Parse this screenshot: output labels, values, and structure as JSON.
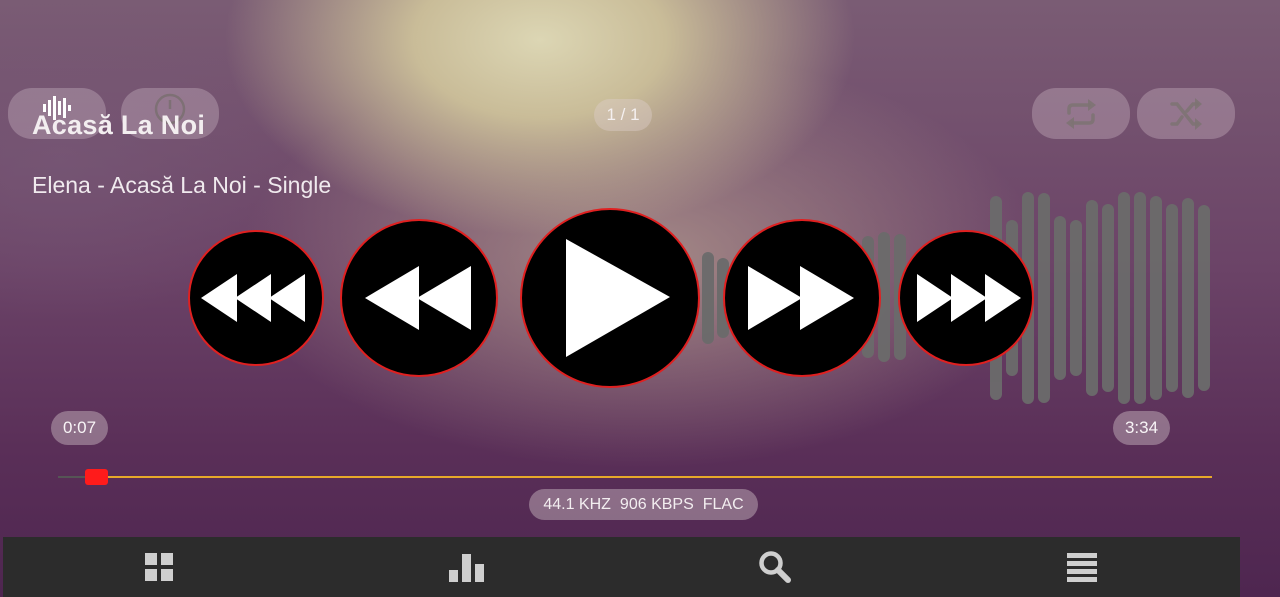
{
  "top_bar": {
    "visualizer_icon": "visualizer-bars-icon",
    "timer_icon": "timer-icon",
    "track_counter": "1 / 1",
    "repeat_icon": "repeat-icon",
    "shuffle_icon": "shuffle-icon"
  },
  "song": {
    "title": "Acasă La Noi",
    "subtitle": "Elena - Acasă La Noi - Single"
  },
  "controls": {
    "fast_rewind_icon": "fast-rewind-icon",
    "previous_icon": "rewind-icon",
    "play_icon": "play-icon",
    "next_icon": "forward-icon",
    "fast_forward_icon": "fast-forward-icon",
    "accent_color": "#e02020"
  },
  "progress": {
    "elapsed": "0:07",
    "duration": "3:34",
    "fraction": 0.033,
    "fill_color": "#e7a92a",
    "thumb_color": "#ff1b1b"
  },
  "audio_format": {
    "sample_rate": "44.1 KHZ",
    "bitrate": "906 KBPS",
    "codec": "FLAC"
  },
  "nav": [
    {
      "icon": "grid-icon"
    },
    {
      "icon": "bar-chart-icon"
    },
    {
      "icon": "search-icon"
    },
    {
      "icon": "menu-icon"
    }
  ]
}
